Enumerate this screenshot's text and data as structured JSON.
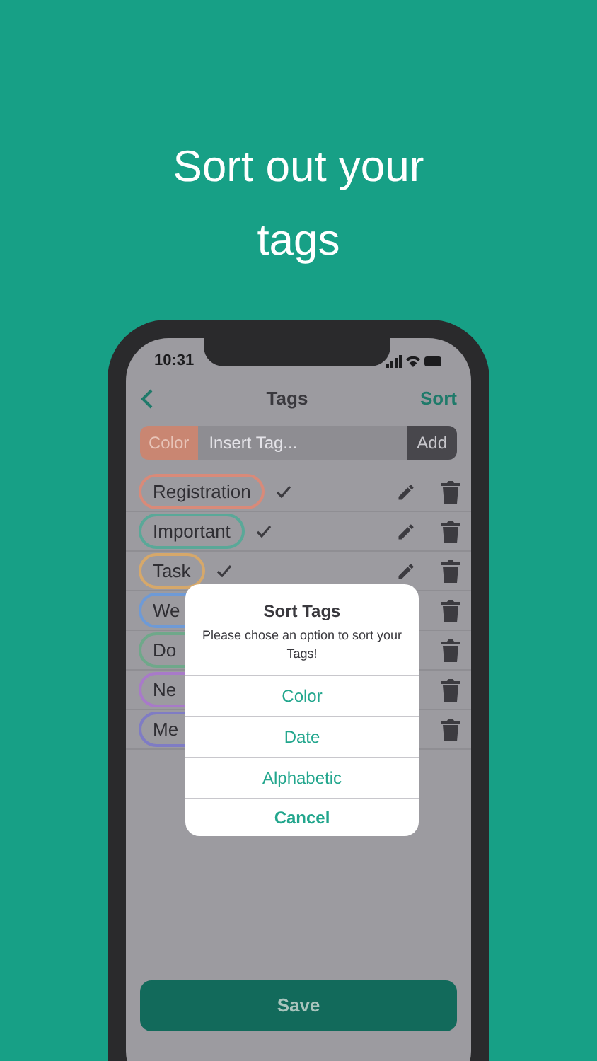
{
  "headline": [
    "Sort out your",
    "tags"
  ],
  "status_bar": {
    "time": "10:31"
  },
  "nav": {
    "title": "Tags",
    "action": "Sort"
  },
  "tag_input": {
    "color_label": "Color",
    "placeholder": "Insert Tag...",
    "add": "Add"
  },
  "tags": [
    {
      "kind": "full",
      "label": "Registration",
      "color": "#d98a79",
      "checked": true
    },
    {
      "kind": "full",
      "label": "Important",
      "color": "#5aa898",
      "checked": true
    },
    {
      "kind": "full",
      "label": "Task",
      "color": "#d6a86a",
      "checked": true
    },
    {
      "kind": "covered",
      "label": "We",
      "color": "#6e9ad6"
    },
    {
      "kind": "covered",
      "label": "Do",
      "color": "#6fa88a"
    },
    {
      "kind": "covered",
      "label": "Ne",
      "color": "#a87ac9"
    },
    {
      "kind": "covered",
      "label": "Me",
      "color": "#7f7cc4"
    }
  ],
  "dialog": {
    "title": "Sort Tags",
    "message": "Please chose an option to sort your Tags!",
    "options": [
      "Color",
      "Date",
      "Alphabetic"
    ],
    "cancel": "Cancel"
  },
  "save": "Save"
}
